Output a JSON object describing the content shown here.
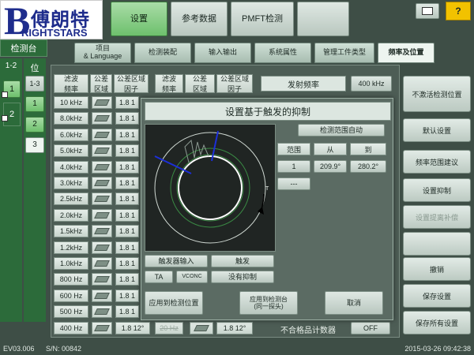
{
  "logo": {
    "brand_cn": "傅朗特",
    "brand_en": "RIGHTSTARS",
    "letter": "B"
  },
  "top_tabs": [
    "设置",
    "参考数据",
    "PMFT检测"
  ],
  "top_icons": {
    "print": "printer-icon",
    "help": "?"
  },
  "left": {
    "header": "检测台",
    "col1_label": "1-2",
    "col2_label": "位",
    "pos_items": [
      "1-3",
      "1",
      "2",
      "3"
    ],
    "green_items": [
      "1",
      "2"
    ]
  },
  "sub_tabs": [
    "项目\n& Language",
    "检测装配",
    "输入输出",
    "系统属性",
    "管理工件类型",
    "频率及位置"
  ],
  "grid_headers": [
    "滤波\n频率",
    "公差\n区域",
    "公差区域\n因子",
    "滤波\n频率",
    "公差\n区域",
    "公差区域\n因子"
  ],
  "frequencies": [
    "10 kHz",
    "8.0kHz",
    "6.0kHz",
    "5.0kHz",
    "4.0kHz",
    "3.0kHz",
    "2.5kHz",
    "2.0kHz",
    "1.5kHz",
    "1.2kHz",
    "1.0kHz",
    "800 Hz",
    "600 Hz",
    "500 Hz",
    "400 Hz"
  ],
  "factor_short": "1.8 1",
  "bottom_row": {
    "freq": "400 Hz",
    "factor": "1.8 12°",
    "factor2": "1.8 12°",
    "mid": "20 Hz"
  },
  "transmit": {
    "label": "发射频率",
    "value": "400 kHz"
  },
  "dialog": {
    "title": "设置基于触发的抑制",
    "range_auto": "检测范围自动",
    "table_headers": [
      "范围",
      "从",
      "到"
    ],
    "row": [
      "1",
      "209.9°",
      "280.2°"
    ],
    "dash": "---",
    "marker": "T",
    "trigger_input": "触发器输入",
    "trigger": "触发",
    "ta": "TA",
    "vconc": "VCONC",
    "no_suppress": "没有抑制",
    "apply_pos": "应用到检测位置",
    "apply_station": "应用到检测台\n(同一探头)",
    "cancel": "取消"
  },
  "reject_counter": {
    "label": "不合格品计数器",
    "value": "OFF"
  },
  "right_buttons": [
    {
      "label": "不激活检测位置",
      "enabled": true
    },
    {
      "label": "默认设置",
      "enabled": true
    },
    {
      "label": "频率范围建议",
      "enabled": true
    },
    {
      "label": "设置抑制",
      "enabled": true
    },
    {
      "label": "设置提离补偿",
      "enabled": false
    },
    {
      "label": "",
      "enabled": true
    },
    {
      "label": "撤销",
      "enabled": true
    },
    {
      "label": "保存设置",
      "enabled": true
    },
    {
      "label": "保存所有设置",
      "enabled": true
    }
  ],
  "status": {
    "version": "EV03.006",
    "serial": "S/N: 00842",
    "datetime": "2015-03-26  09:42:38"
  },
  "colors": {
    "bg": "#3e4e46",
    "green": "#6ec06d",
    "accent_yellow": "#f2c200",
    "blue_line": "#1c2fd9"
  }
}
